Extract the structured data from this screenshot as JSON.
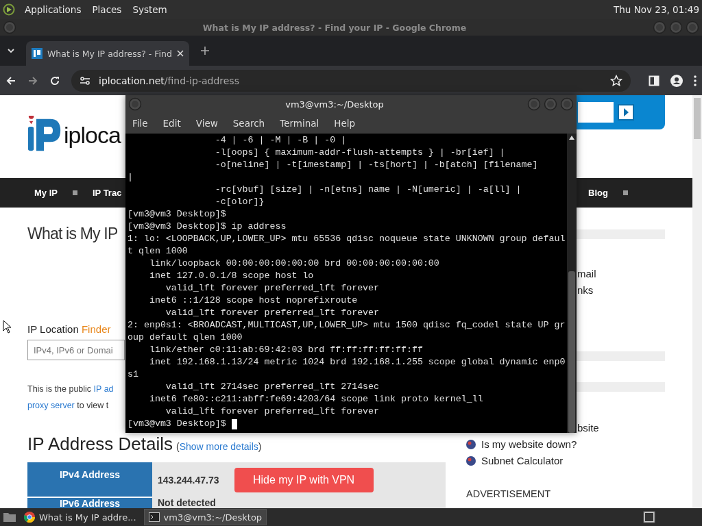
{
  "top_panel": {
    "menus": [
      "Applications",
      "Places",
      "System"
    ],
    "clock": "Thu Nov 23, 01:49"
  },
  "browser": {
    "title": "What is My IP address? - Find your IP - Google Chrome",
    "tabs": [
      {
        "label": "What is My IP address? - Find",
        "selected": true
      }
    ],
    "url": {
      "domain": "iplocation.net",
      "path": "/find-ip-address"
    },
    "page": {
      "logo_text": "iploca",
      "nav": [
        "My IP",
        "IP Trac",
        "Blog"
      ],
      "heading": "What is My IP",
      "finder": {
        "label": "IP Location",
        "accent": "Finder",
        "placeholder": "IPv4, IPv6 or Domai"
      },
      "intro": {
        "start": "This is the public ",
        "link1": "IP ad",
        "link2": "proxy server",
        "end": " to view t"
      },
      "details_title": "IP Address Details",
      "details_open": "(",
      "details_link": "Show more details",
      "details_close": ")",
      "rows": [
        {
          "label": "IPv4 Address",
          "value": "143.244.47.73",
          "button": "Hide my IP with VPN"
        },
        {
          "label": "IPv6 Address",
          "value": "Not detected"
        }
      ],
      "side_upper": [
        "mail",
        "nks"
      ],
      "side_lower": [
        {
          "text": "bsite",
          "icon": false
        },
        {
          "text": "Is my website down?",
          "icon": true
        },
        {
          "text": "Subnet Calculator",
          "icon": true
        }
      ],
      "advert": "ADVERTISEMENT"
    }
  },
  "terminal": {
    "title": "vm3@vm3:~/Desktop",
    "menus": [
      "File",
      "Edit",
      "View",
      "Search",
      "Terminal",
      "Help"
    ],
    "lines": [
      "                -4 | -6 | -M | -B | -0 |",
      "                -l[oops] { maximum-addr-flush-attempts } | -br[ief] |",
      "                -o[neline] | -t[imestamp] | -ts[hort] | -b[atch] [filename]",
      "|",
      "                -rc[vbuf] [size] | -n[etns] name | -N[umeric] | -a[ll] |",
      "                -c[olor]}",
      "[vm3@vm3 Desktop]$",
      "[vm3@vm3 Desktop]$ ip address",
      "1: lo: <LOOPBACK,UP,LOWER_UP> mtu 65536 qdisc noqueue state UNKNOWN group defaul",
      "t qlen 1000",
      "    link/loopback 00:00:00:00:00:00 brd 00:00:00:00:00:00",
      "    inet 127.0.0.1/8 scope host lo",
      "       valid_lft forever preferred_lft forever",
      "    inet6 ::1/128 scope host noprefixroute",
      "       valid_lft forever preferred_lft forever",
      "2: enp0s1: <BROADCAST,MULTICAST,UP,LOWER_UP> mtu 1500 qdisc fq_codel state UP gr",
      "oup default qlen 1000",
      "    link/ether c0:11:ab:69:42:03 brd ff:ff:ff:ff:ff:ff",
      "    inet 192.168.1.13/24 metric 1024 brd 192.168.1.255 scope global dynamic enp0",
      "s1",
      "       valid_lft 2714sec preferred_lft 2714sec",
      "    inet6 fe80::c211:abff:fe69:4203/64 scope link proto kernel_ll",
      "       valid_lft forever preferred_lft forever"
    ],
    "prompt": "[vm3@vm3 Desktop]$ "
  },
  "taskbar": [
    {
      "label": "What is My IP addre...",
      "kind": "browser",
      "selected": false
    },
    {
      "label": "vm3@vm3:~/Desktop",
      "kind": "terminal",
      "selected": true
    }
  ]
}
